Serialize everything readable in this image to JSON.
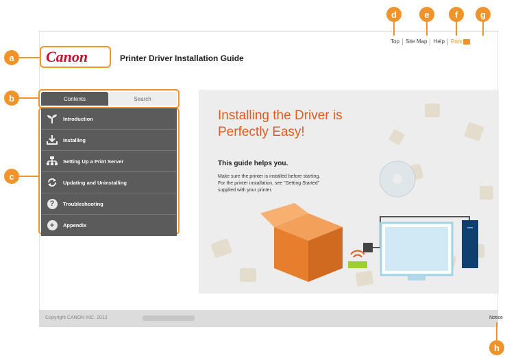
{
  "callouts": {
    "a": "a",
    "b": "b",
    "c": "c",
    "d": "d",
    "e": "e",
    "f": "f",
    "g": "g",
    "h": "h"
  },
  "header": {
    "logo": "Canon",
    "title": "Printer Driver Installation Guide",
    "links": {
      "top": "Top",
      "site_map": "Site Map",
      "help": "Help",
      "print": "Print"
    }
  },
  "tabs": {
    "contents": "Contents",
    "search": "Search"
  },
  "nav": [
    {
      "label": "Introduction",
      "icon": "sprout-icon"
    },
    {
      "label": "Installing",
      "icon": "download-icon"
    },
    {
      "label": "Setting Up a Print Server",
      "icon": "network-icon"
    },
    {
      "label": "Updating and Uninstalling",
      "icon": "refresh-icon"
    },
    {
      "label": "Troubleshooting",
      "icon": "question-icon"
    },
    {
      "label": "Appendix",
      "icon": "plus-icon"
    }
  ],
  "hero": {
    "title_line1": "Installing the Driver is",
    "title_line2": "Perfectly Easy!",
    "subtitle": "This guide helps you.",
    "text_line1": "Make sure the printer is installed before starting.",
    "text_line2": "For the printer installation, see \"Getting Started\"",
    "text_line3": "supplied with your printer."
  },
  "footer": {
    "copyright": "Copyright CANON INC. 2013",
    "notice": "Notice"
  },
  "colors": {
    "accent": "#f0932b",
    "brand": "#c8102e",
    "hero_title": "#e35a1f",
    "nav_bg": "#5b5b5b"
  }
}
